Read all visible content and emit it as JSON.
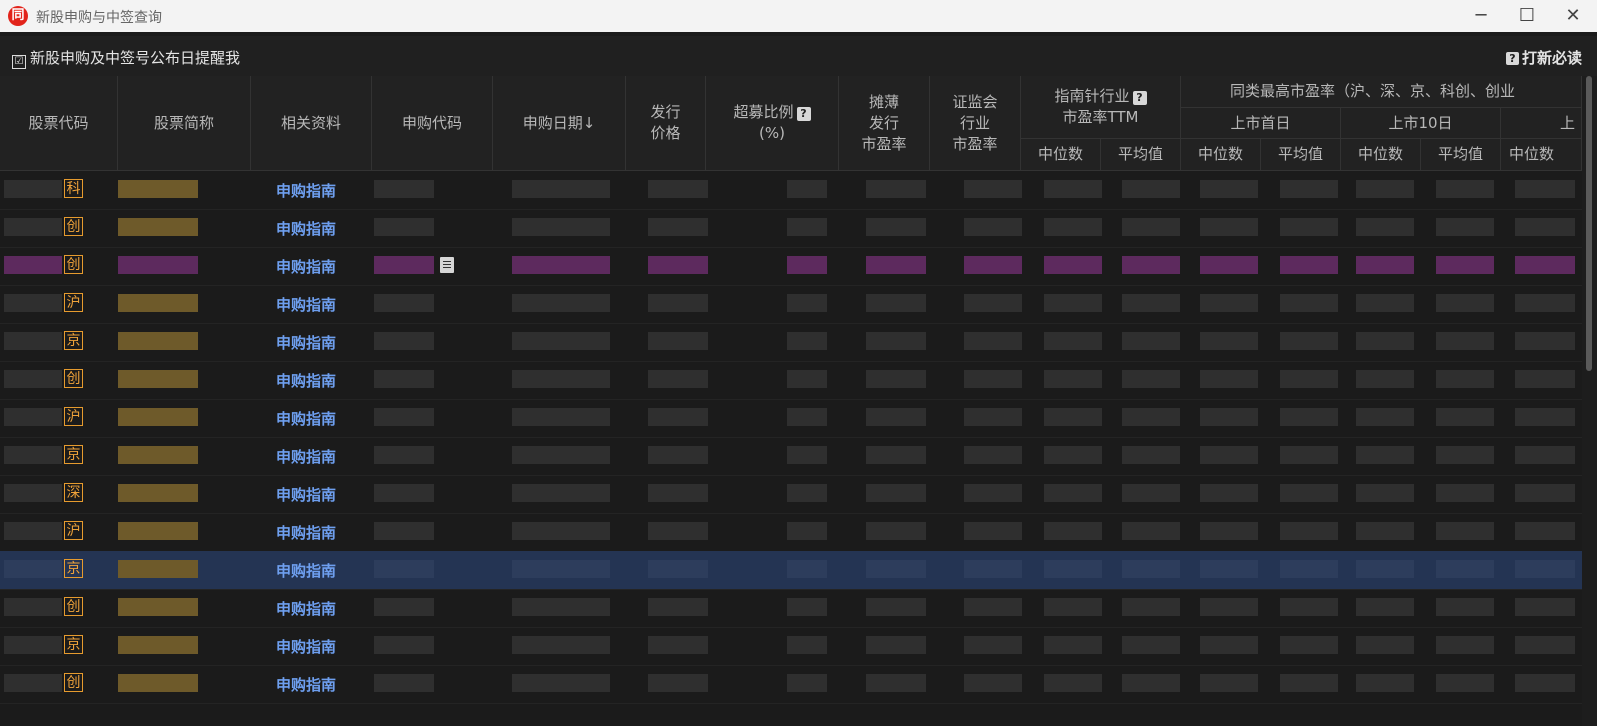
{
  "window": {
    "title": "新股申购与中签查询",
    "logo": "同",
    "buttons": {
      "minimize": "─",
      "maximize": "☐",
      "close": "✕"
    }
  },
  "toolbar": {
    "remind_check": "☑",
    "remind_label": "新股申购及中签号公布日提醒我",
    "must_read_icon": "?",
    "must_read_label": "打新必读"
  },
  "columns": {
    "stock_code": "股票代码",
    "stock_name": "股票简称",
    "related": "相关资料",
    "sub_code": "申购代码",
    "sub_date": "申购日期↓",
    "price_l1": "发行",
    "price_l2": "价格",
    "over_l1": "超募比例",
    "over_l2": "(%)",
    "diluted_l1": "摊薄",
    "diluted_l2": "发行",
    "diluted_l3": "市盈率",
    "csrc_l1": "证监会",
    "csrc_l2": "行业",
    "csrc_l3": "市盈率",
    "ind_l1": "指南针行业",
    "ind_l2": "市盈率TTM",
    "peer_top": "同类最高市盈率（沪、深、京、科创、创业",
    "first_day": "上市首日",
    "day10": "上市10日",
    "more": "上",
    "median": "中位数",
    "mean": "平均值",
    "median_cut": "中位数",
    "help_icon": "?"
  },
  "rows": [
    {
      "board": "科",
      "guide": "申购指南"
    },
    {
      "board": "创",
      "guide": "申购指南"
    },
    {
      "board": "创",
      "guide": "申购指南",
      "highlight": "purple"
    },
    {
      "board": "沪",
      "guide": "申购指南"
    },
    {
      "board": "京",
      "guide": "申购指南"
    },
    {
      "board": "创",
      "guide": "申购指南"
    },
    {
      "board": "沪",
      "guide": "申购指南"
    },
    {
      "board": "京",
      "guide": "申购指南"
    },
    {
      "board": "深",
      "guide": "申购指南"
    },
    {
      "board": "沪",
      "guide": "申购指南"
    },
    {
      "board": "京",
      "guide": "申购指南",
      "selected": true
    },
    {
      "board": "创",
      "guide": "申购指南"
    },
    {
      "board": "京",
      "guide": "申购指南"
    },
    {
      "board": "创",
      "guide": "申购指南"
    }
  ],
  "colors": {
    "board_orange": "#f0a33a",
    "guide_blue": "#6e9fef",
    "selected_row": "#243453",
    "name_gold": "#6e5a2a",
    "purple": "#5d2a5e"
  }
}
